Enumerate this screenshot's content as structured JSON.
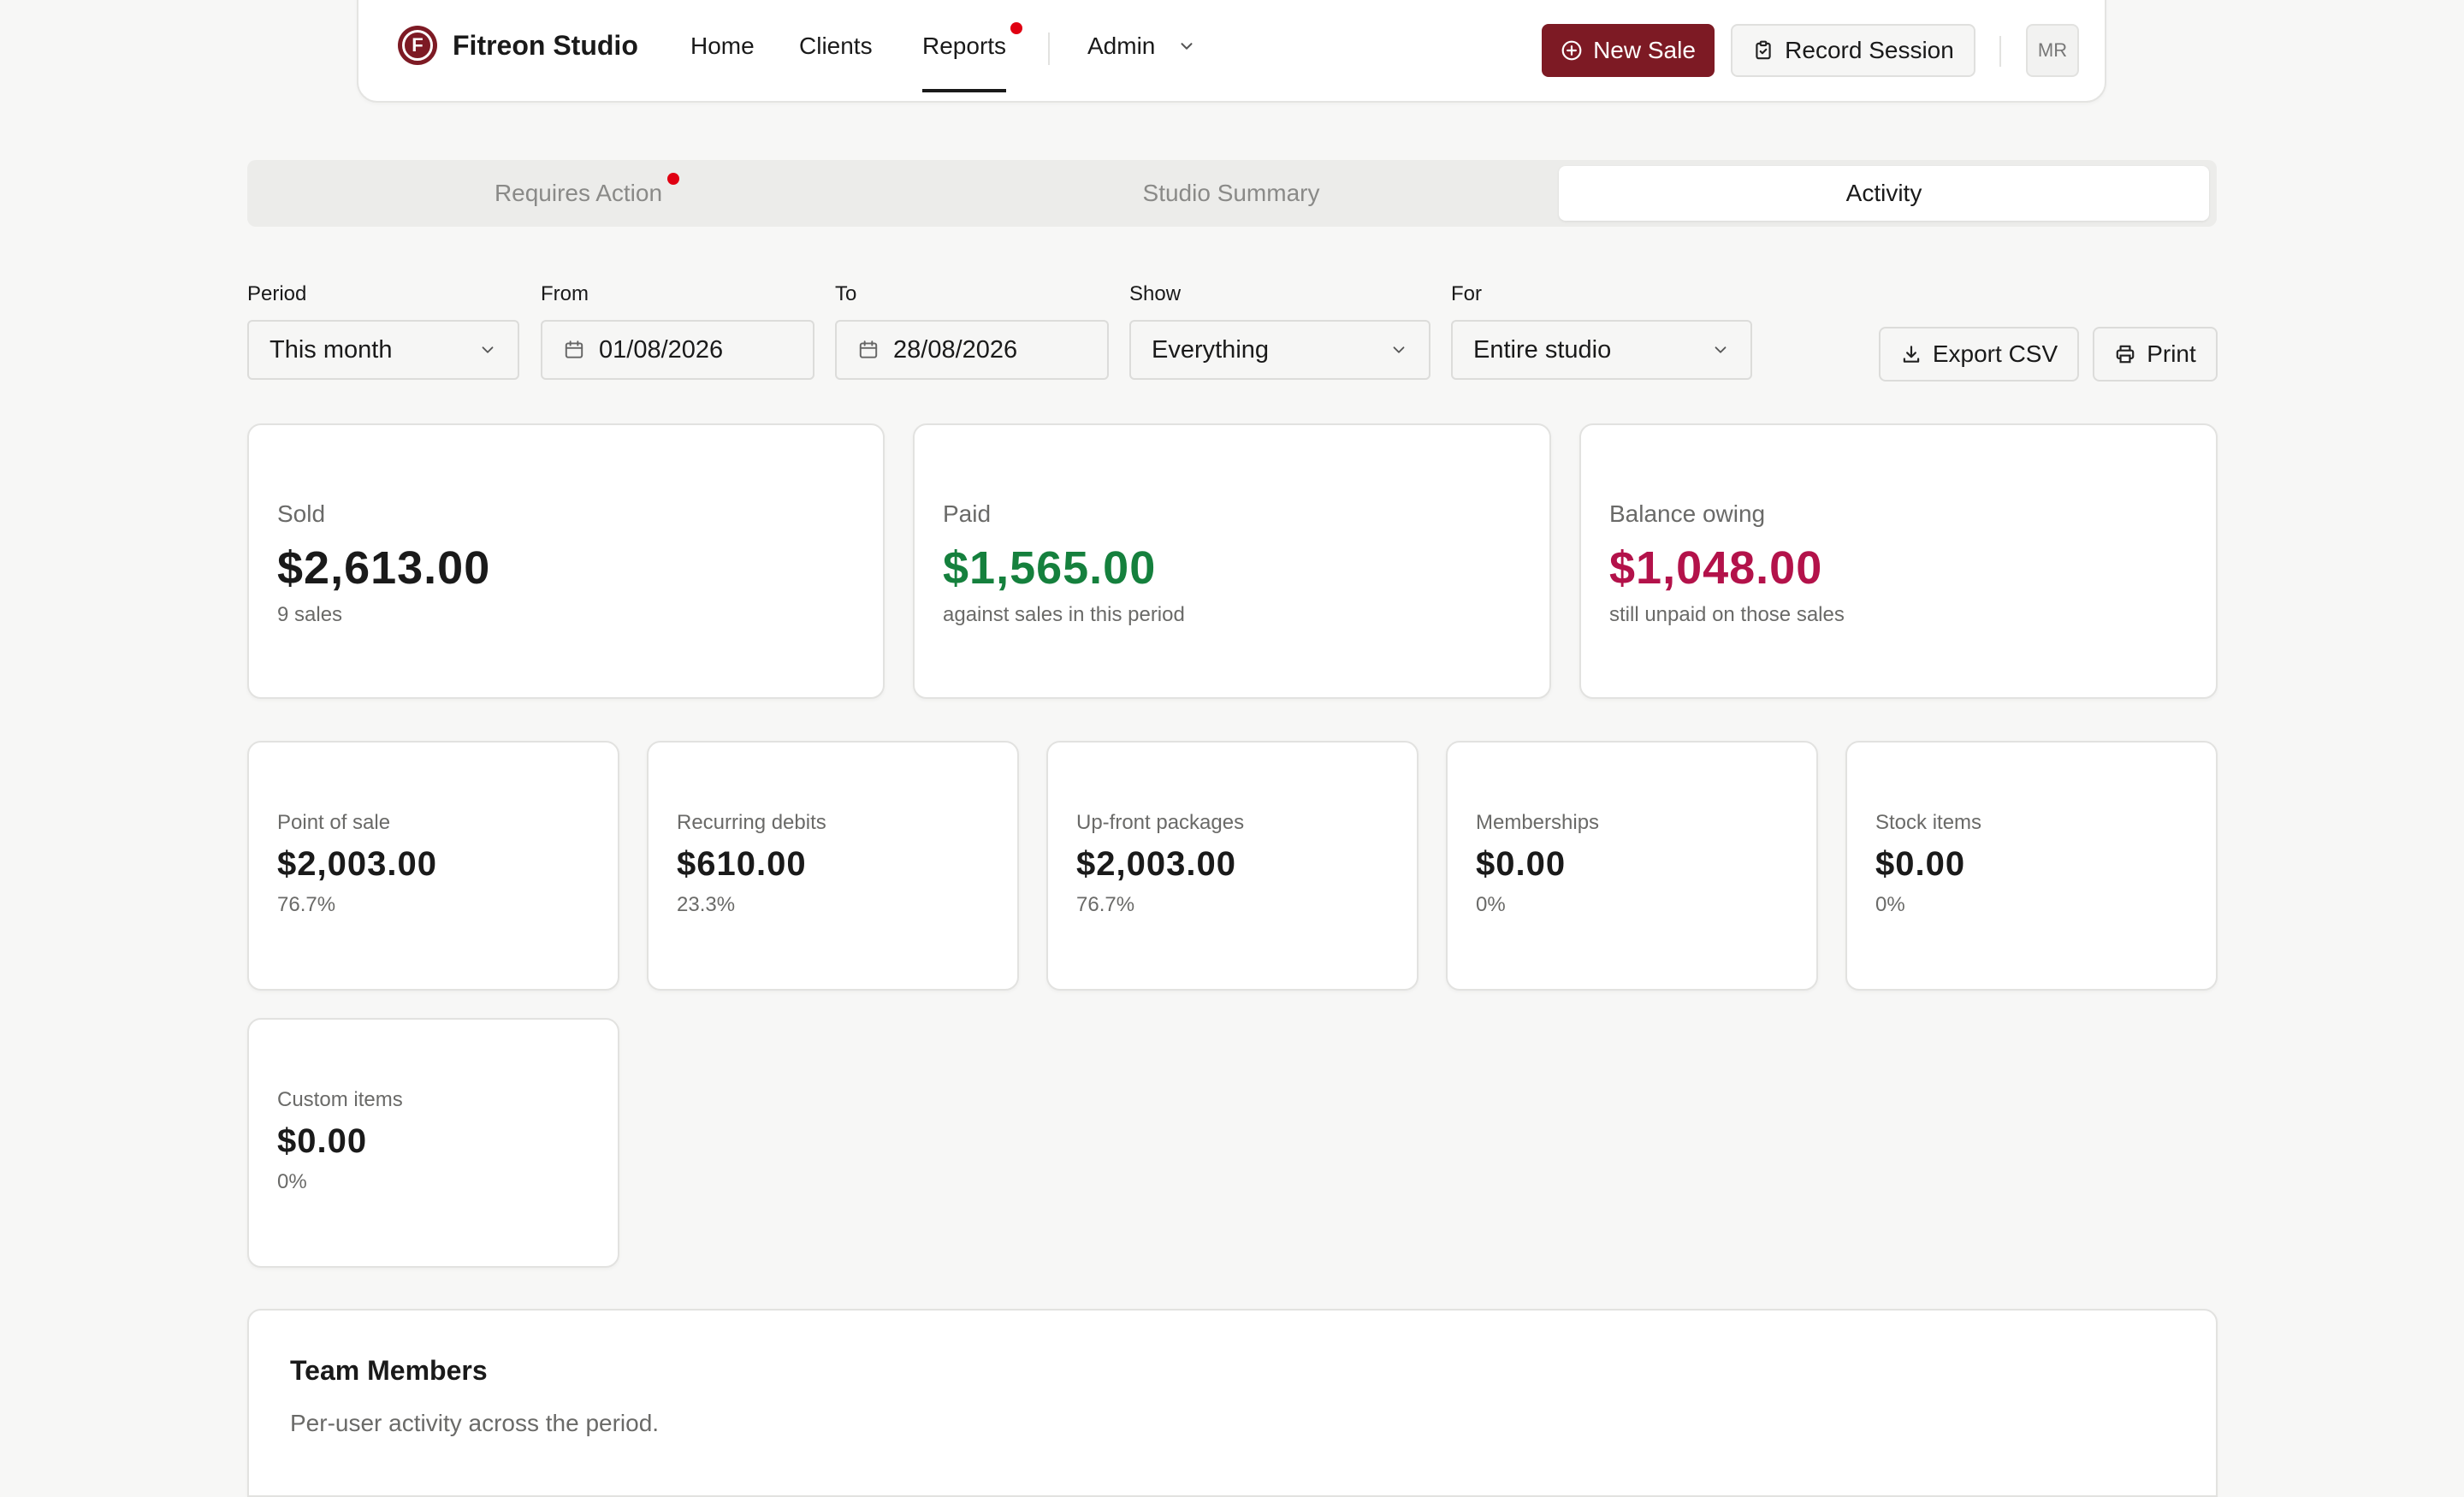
{
  "brand": {
    "name": "Fitreon Studio",
    "logo_letter": "F"
  },
  "nav": {
    "links": [
      "Home",
      "Clients",
      "Reports",
      "Admin"
    ],
    "active": "Reports"
  },
  "header_actions": {
    "new_sale": "New Sale",
    "record_session": "Record Session",
    "avatar_initials": "MR"
  },
  "tabs": [
    {
      "label": "Requires Action",
      "has_dot": true
    },
    {
      "label": "Studio Summary",
      "has_dot": false
    },
    {
      "label": "Activity",
      "active": true
    }
  ],
  "filters": {
    "period": {
      "label": "Period",
      "value": "This month"
    },
    "from": {
      "label": "From",
      "value": "01/08/2026"
    },
    "to": {
      "label": "To",
      "value": "28/08/2026"
    },
    "show": {
      "label": "Show",
      "value": "Everything"
    },
    "for": {
      "label": "For",
      "value": "Entire studio"
    }
  },
  "actions": {
    "export": "Export CSV",
    "print": "Print"
  },
  "summary": [
    {
      "label": "Sold",
      "value": "$2,613.00",
      "sub": "9 sales",
      "color": "#1a1a1a"
    },
    {
      "label": "Paid",
      "value": "$1,565.00",
      "sub": "against sales in this period",
      "color": "#15803d"
    },
    {
      "label": "Balance owing",
      "value": "$1,048.00",
      "sub": "still unpaid on those sales",
      "color": "#b3124a"
    }
  ],
  "breakdown": [
    {
      "label": "Point of sale",
      "value": "$2,003.00",
      "sub": "76.7%"
    },
    {
      "label": "Recurring debits",
      "value": "$610.00",
      "sub": "23.3%"
    },
    {
      "label": "Up-front packages",
      "value": "$2,003.00",
      "sub": "76.7%"
    },
    {
      "label": "Memberships",
      "value": "$0.00",
      "sub": "0%"
    },
    {
      "label": "Stock items",
      "value": "$0.00",
      "sub": "0%"
    },
    {
      "label": "Custom items",
      "value": "$0.00",
      "sub": "0%"
    }
  ],
  "team": {
    "title": "Team Members",
    "subtitle": "Per-user activity across the period."
  },
  "colors": {
    "brand": "#7d1a24",
    "paid": "#15803d",
    "owing": "#b3124a",
    "notification": "#e00012"
  }
}
